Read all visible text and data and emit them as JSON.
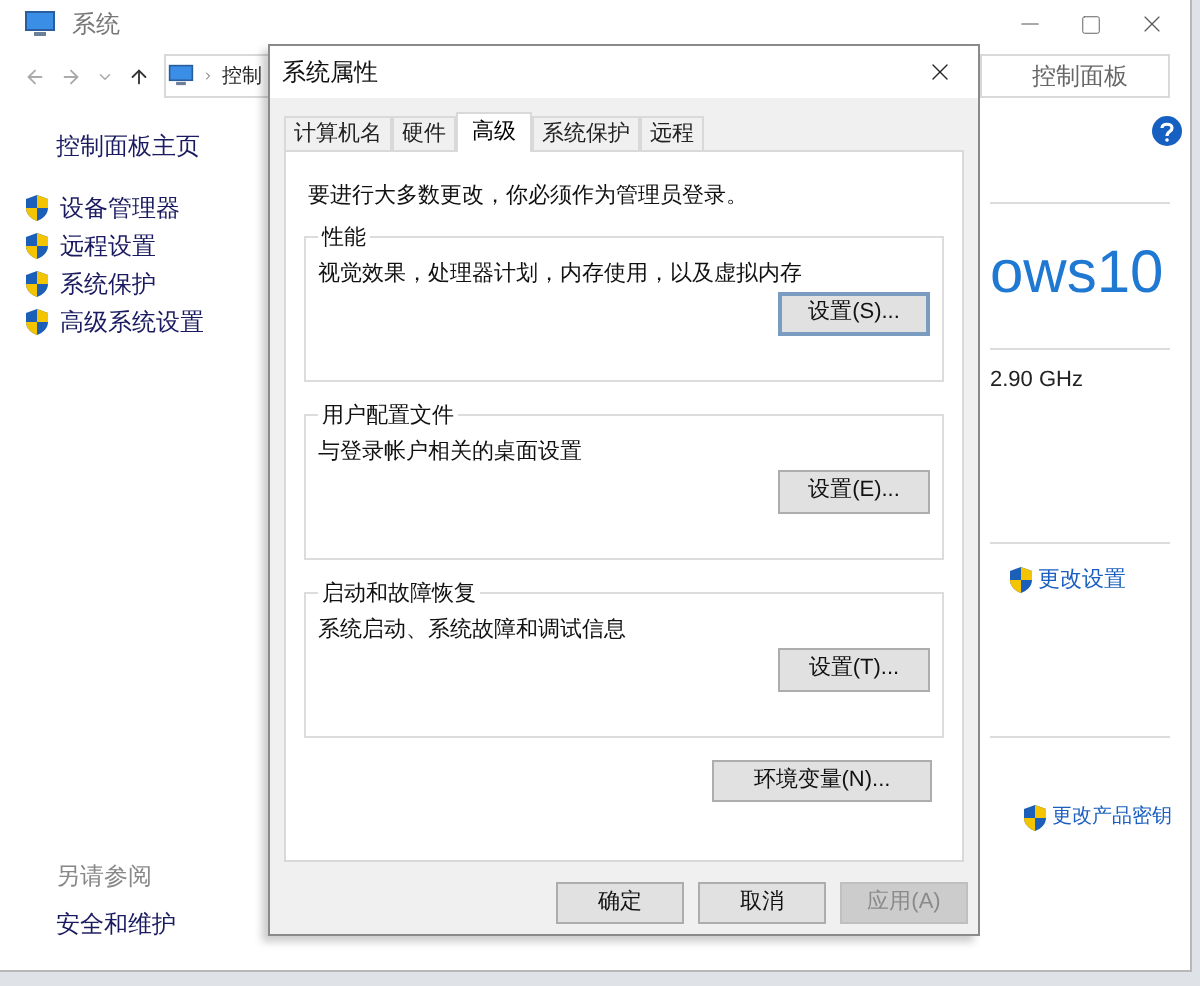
{
  "window": {
    "title": "系统"
  },
  "address": {
    "crumb": "控制",
    "search_placeholder": "控制面板"
  },
  "sidebar": {
    "home": "控制面板主页",
    "items": [
      {
        "label": "设备管理器"
      },
      {
        "label": "远程设置"
      },
      {
        "label": "系统保护"
      },
      {
        "label": "高级系统设置"
      }
    ],
    "see_also": "另请参阅",
    "links": [
      "安全和维护"
    ]
  },
  "main": {
    "logo_text": "ows10",
    "cpu_speed": "2.90 GHz",
    "change_settings": "更改设置",
    "change_key": "更改产品密钥"
  },
  "dialog": {
    "title": "系统属性",
    "tabs": [
      {
        "label": "计算机名",
        "selected": false
      },
      {
        "label": "硬件",
        "selected": false
      },
      {
        "label": "高级",
        "selected": true
      },
      {
        "label": "系统保护",
        "selected": false
      },
      {
        "label": "远程",
        "selected": false
      }
    ],
    "notice": "要进行大多数更改，你必须作为管理员登录。",
    "groups": [
      {
        "title": "性能",
        "description": "视觉效果，处理器计划，内存使用，以及虚拟内存",
        "button": "设置(S)...",
        "focused": true
      },
      {
        "title": "用户配置文件",
        "description": "与登录帐户相关的桌面设置",
        "button": "设置(E)...",
        "focused": false
      },
      {
        "title": "启动和故障恢复",
        "description": "系统启动、系统故障和调试信息",
        "button": "设置(T)...",
        "focused": false
      }
    ],
    "env_button": "环境变量(N)...",
    "buttons": [
      {
        "label": "确定",
        "disabled": false
      },
      {
        "label": "取消",
        "disabled": false
      },
      {
        "label": "应用(A)",
        "disabled": true
      }
    ]
  }
}
